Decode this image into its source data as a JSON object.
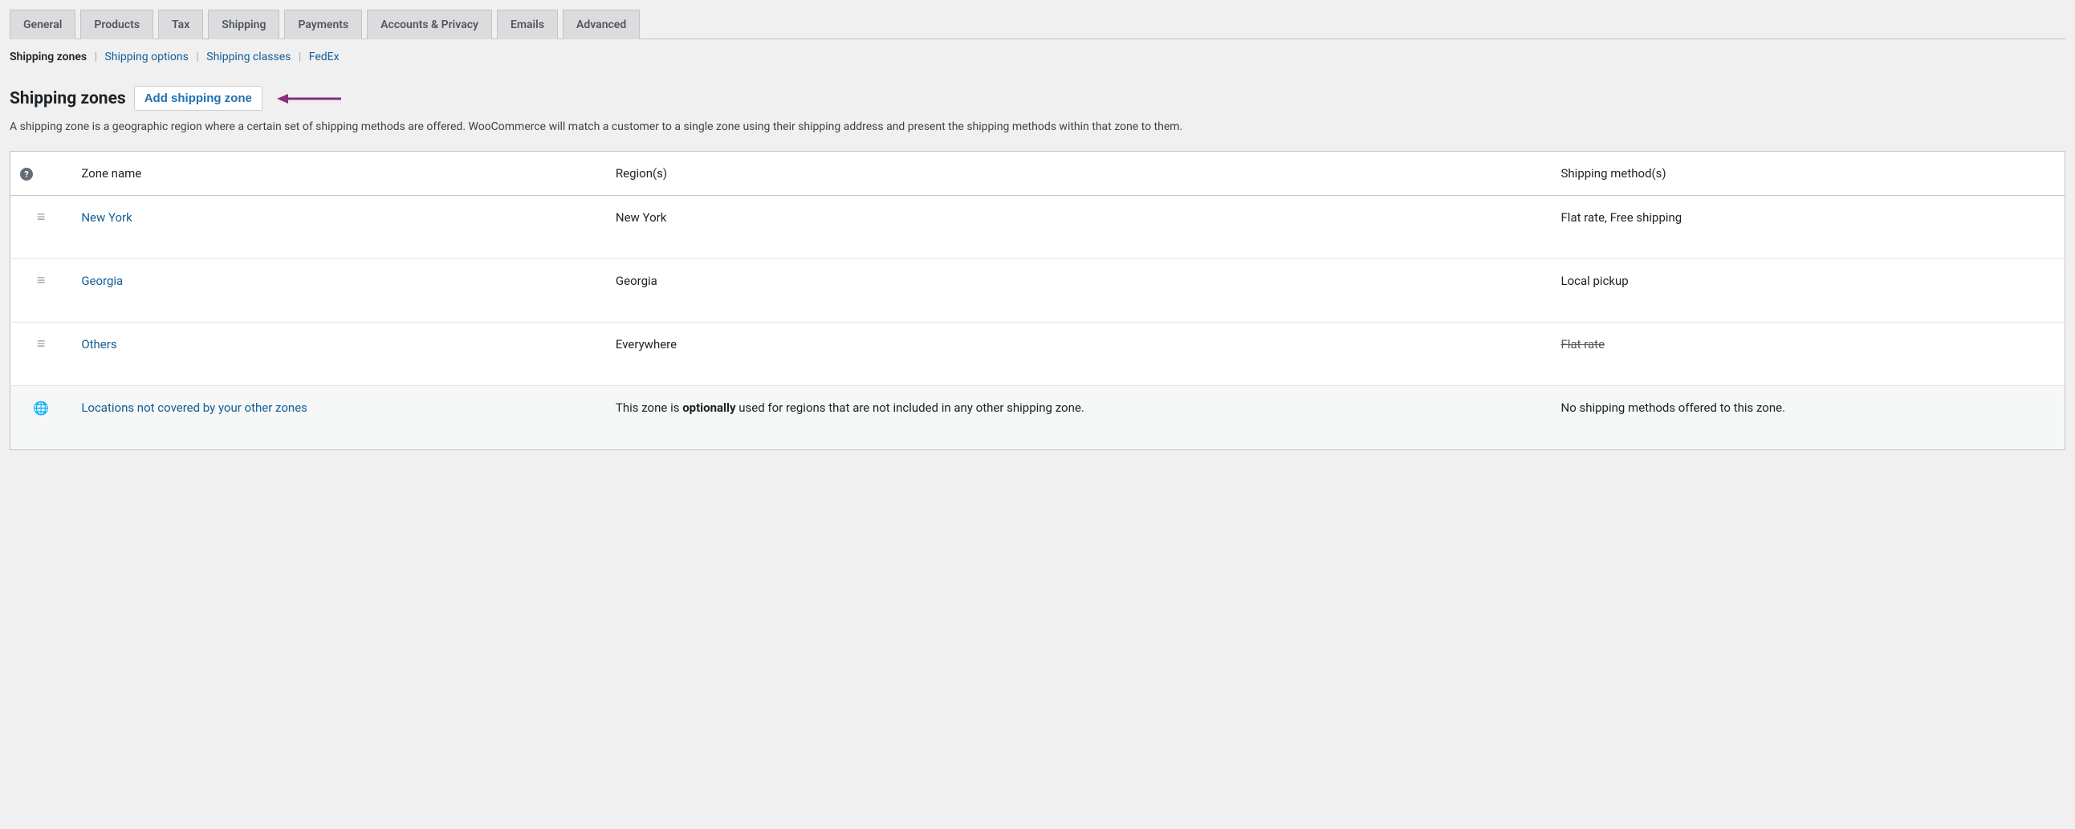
{
  "tabs": {
    "general": "General",
    "products": "Products",
    "tax": "Tax",
    "shipping": "Shipping",
    "payments": "Payments",
    "accounts": "Accounts & Privacy",
    "emails": "Emails",
    "advanced": "Advanced"
  },
  "subnav": {
    "zones": "Shipping zones",
    "options": "Shipping options",
    "classes": "Shipping classes",
    "fedex": "FedEx"
  },
  "heading": "Shipping zones",
  "add_zone_label": "Add shipping zone",
  "description": "A shipping zone is a geographic region where a certain set of shipping methods are offered. WooCommerce will match a customer to a single zone using their shipping address and present the shipping methods within that zone to them.",
  "table": {
    "head": {
      "zone_name": "Zone name",
      "regions": "Region(s)",
      "methods": "Shipping method(s)"
    },
    "rows": [
      {
        "name": "New York",
        "region": "New York",
        "methods": "Flat rate, Free shipping",
        "methods_struck": false
      },
      {
        "name": "Georgia",
        "region": "Georgia",
        "methods": "Local pickup",
        "methods_struck": false
      },
      {
        "name": "Others",
        "region": "Everywhere",
        "methods": "Flat rate",
        "methods_struck": true
      }
    ],
    "fallback": {
      "name": "Locations not covered by your other zones",
      "region_prefix": "This zone is ",
      "region_bold": "optionally",
      "region_suffix": " used for regions that are not included in any other shipping zone.",
      "methods": "No shipping methods offered to this zone."
    }
  },
  "annotation": {
    "arrow_color": "#8a2d7b"
  }
}
